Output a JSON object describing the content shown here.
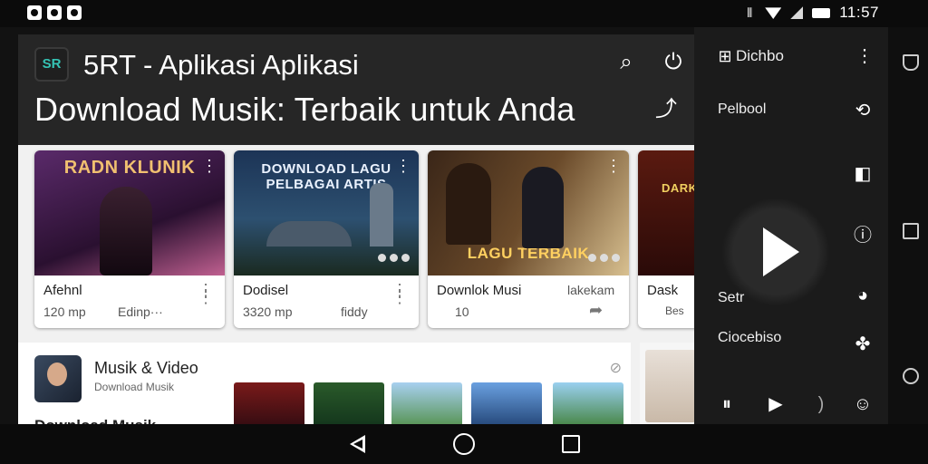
{
  "status_bar": {
    "time": "11:57",
    "icons": [
      "notification-icon",
      "notification-icon",
      "notification-icon",
      "vibrate-icon",
      "wifi-icon",
      "signal-icon",
      "battery-icon"
    ]
  },
  "header": {
    "app_title": "5RT - Aplikasi Aplikasi",
    "logo_text": "SR",
    "page_heading": "Download Musik: Terbaik untuk Anda",
    "icons": [
      "search-icon",
      "power-icon",
      "share-icon"
    ]
  },
  "cards": [
    {
      "art_text": "RADN KLUNIK",
      "title": "Afehnl",
      "meta": "120 mp",
      "extra": "Edinp···",
      "icon": "more-vert-icon"
    },
    {
      "art_text": "DOWNLOAD LAGU PELBAGAI ARTIS",
      "title": "Dodisel",
      "meta": "3320 mp",
      "extra": "fiddy",
      "icon": "more-vert-icon"
    },
    {
      "art_text": "LAGU TERBAIK",
      "title": "Downlok Musi",
      "meta": "10",
      "extra": "lakekam",
      "icon": "share-icon"
    },
    {
      "art_text": "DARK",
      "title": "Dask",
      "meta": "Bes",
      "extra": "",
      "icon": "more-vert-icon"
    }
  ],
  "section": {
    "title": "Musik & Video",
    "subtitle": "Download Musik",
    "footer": "Download Musik"
  },
  "panel": {
    "header_label": "Dichbo",
    "items": [
      {
        "label": "Pelbool",
        "icon": "sync-icon"
      },
      {
        "label": "Setr",
        "icon": "pie-icon"
      },
      {
        "label": "Ciocebiso",
        "icon": "grid-icon"
      }
    ],
    "side_icons": [
      "shield-icon",
      "info-icon"
    ],
    "controls": [
      "pause-icon",
      "play-icon",
      "volume-icon",
      "settings-icon"
    ]
  },
  "colors": {
    "accent": "#35c3b4",
    "header_bg": "#262626",
    "panel_bg": "#1b1b1b",
    "content_bg": "#f1f1f1"
  }
}
